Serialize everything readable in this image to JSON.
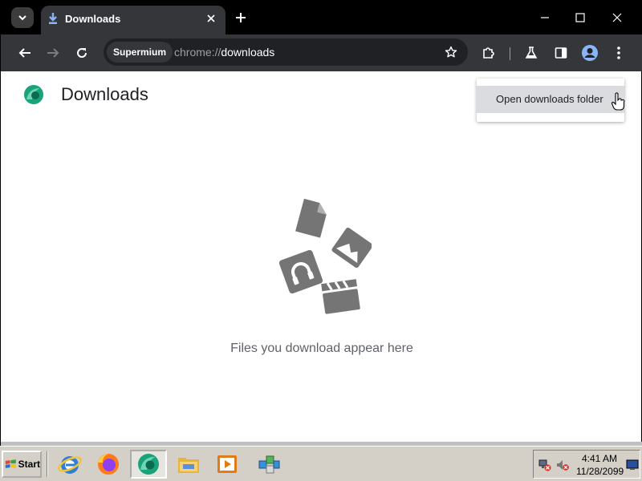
{
  "tab": {
    "title": "Downloads"
  },
  "omnibox": {
    "chip": "Supermium",
    "url_scheme": "chrome://",
    "url_path": "downloads"
  },
  "page": {
    "title": "Downloads",
    "empty_message": "Files you download appear here"
  },
  "menu": {
    "items": [
      {
        "label": "Open downloads folder"
      }
    ]
  },
  "taskbar": {
    "start_label": "Start",
    "apps": [
      "internet-explorer-icon",
      "firefox-icon",
      "supermium-icon",
      "file-explorer-icon",
      "media-player-icon",
      "package-icon"
    ],
    "clock_time": "4:41 AM",
    "clock_date": "11/28/2099"
  },
  "colors": {
    "tabstrip": "#000000",
    "toolbar": "#35363a",
    "accent": "#8ab4f8",
    "menu_highlight": "#dadce0",
    "taskbar": "#d4d0c8"
  }
}
